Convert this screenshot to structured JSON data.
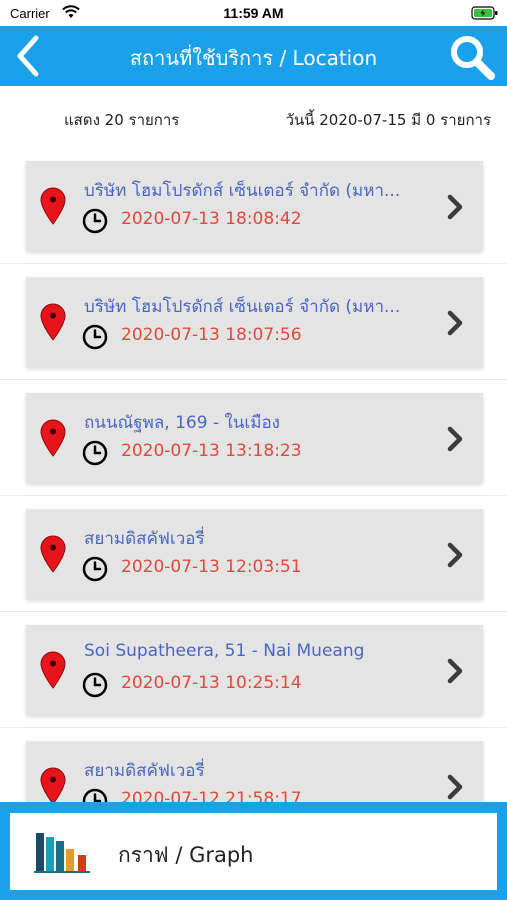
{
  "status_bar": {
    "carrier": "Carrier",
    "time": "11:59 AM"
  },
  "nav": {
    "title": "สถานที่ใช้บริการ / Location",
    "back_icon": "chevron-left-icon",
    "search_icon": "search-icon"
  },
  "summary": {
    "count_text": "แสดง 20 รายการ",
    "today_text": "วันนี้ 2020-07-15 มี 0 รายการ"
  },
  "items": [
    {
      "name": "บริษัท โฮมโปรดักส์ เซ็นเตอร์ จำกัด (มหา...",
      "time": "2020-07-13 18:08:42"
    },
    {
      "name": "บริษัท โฮมโปรดักส์ เซ็นเตอร์ จำกัด (มหา...",
      "time": "2020-07-13 18:07:56"
    },
    {
      "name": "ถนนณัฐพล, 169 - ในเมือง",
      "time": "2020-07-13 13:18:23"
    },
    {
      "name": "สยามดิสคัฟเวอรี่",
      "time": "2020-07-13 12:03:51"
    },
    {
      "name": "Soi Supatheera, 51 - Nai Mueang",
      "time": "2020-07-13 10:25:14"
    },
    {
      "name": "สยามดิสคัฟเวอรี่",
      "time": "2020-07-12 21:58:17"
    }
  ],
  "graph_button": {
    "label": "กราฟ / Graph"
  },
  "colors": {
    "accent": "#1ba0ea",
    "link_blue": "#4a66c8",
    "time_red": "#e24a3a",
    "card_bg": "#e4e4e4"
  }
}
